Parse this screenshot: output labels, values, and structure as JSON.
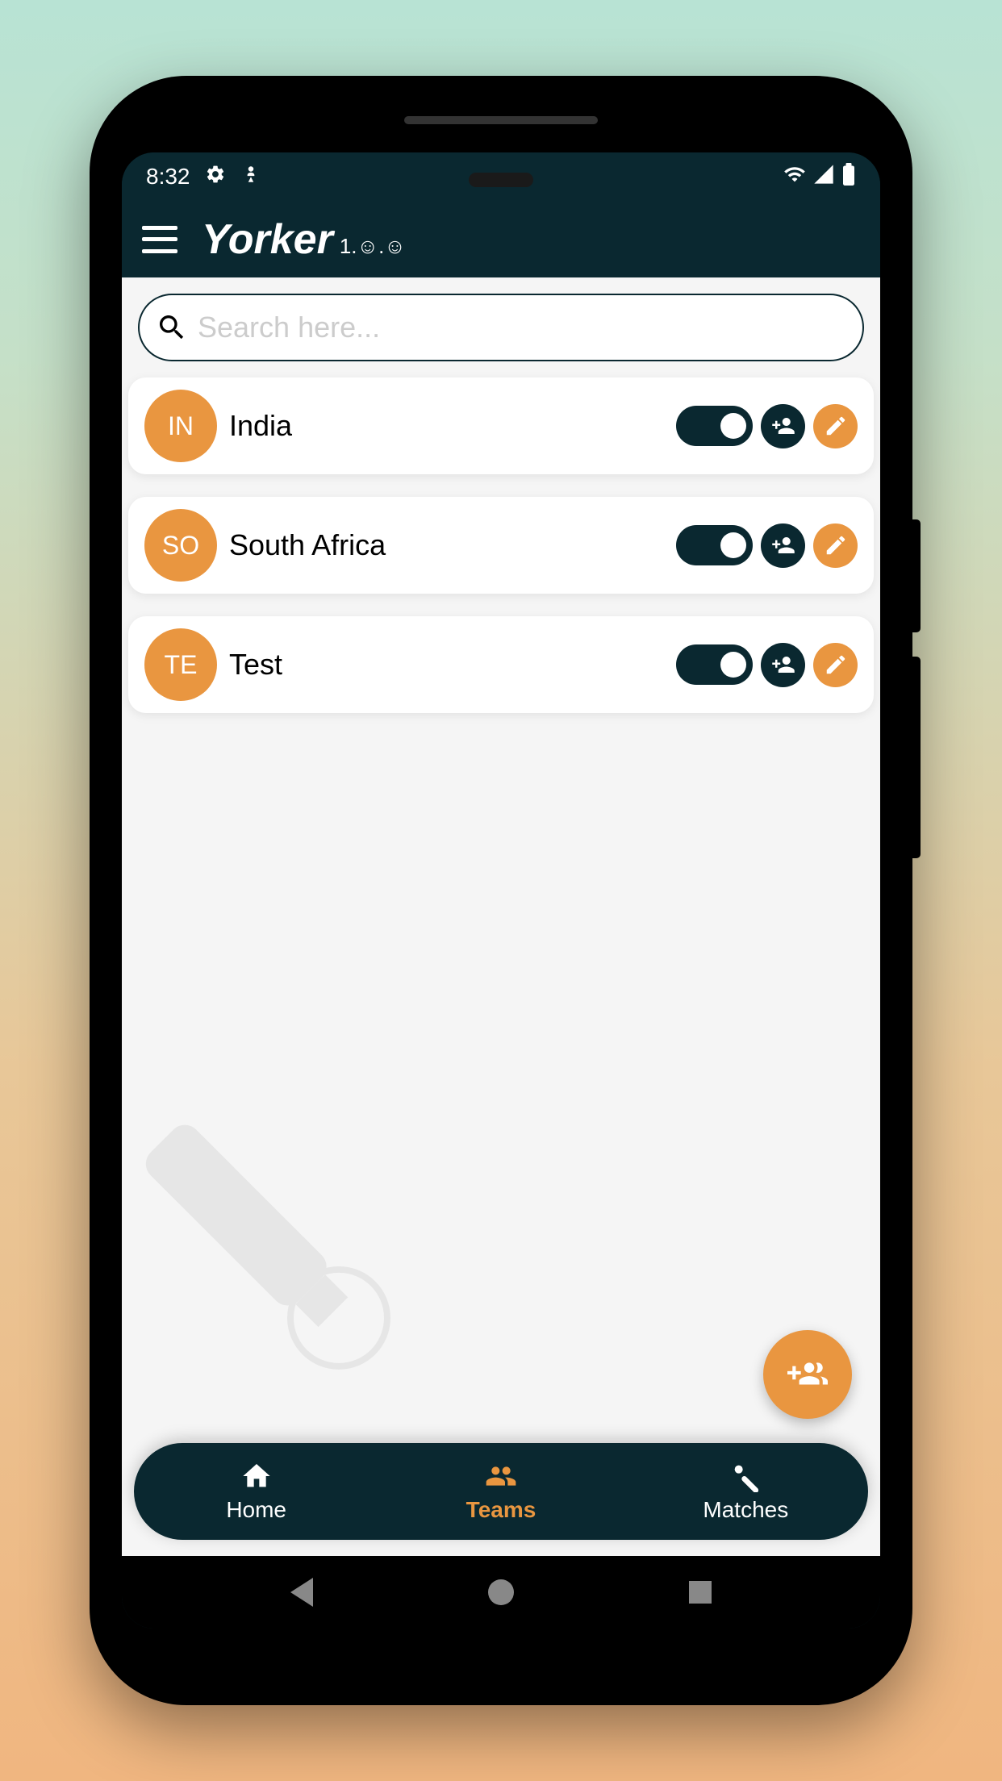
{
  "status": {
    "time": "8:32"
  },
  "header": {
    "app_name": "Yorker",
    "version": "1.0.0"
  },
  "search": {
    "placeholder": "Search here..."
  },
  "teams": [
    {
      "initials": "IN",
      "name": "India",
      "active": true
    },
    {
      "initials": "SO",
      "name": "South Africa",
      "active": true
    },
    {
      "initials": "TE",
      "name": "Test",
      "active": true
    }
  ],
  "nav": {
    "home_label": "Home",
    "teams_label": "Teams",
    "matches_label": "Matches",
    "active_tab": "teams"
  },
  "colors": {
    "accent": "#e99640",
    "dark": "#0a2830"
  }
}
